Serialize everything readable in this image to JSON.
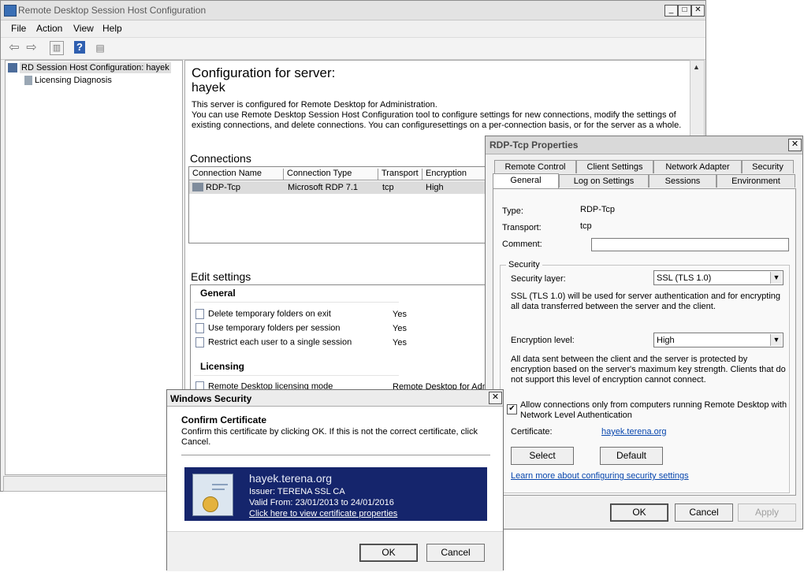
{
  "main_window": {
    "title": "Remote Desktop Session Host Configuration",
    "controls": {
      "minimize": "_",
      "maximize": "□",
      "close": "✕"
    },
    "menu": [
      "File",
      "Action",
      "View",
      "Help"
    ]
  },
  "tree": {
    "root": "RD Session Host Configuration: hayek",
    "child": "Licensing Diagnosis"
  },
  "content": {
    "heading": "Configuration for server:",
    "server": "hayek",
    "desc_line1": "This server is configured for Remote Desktop for Administration.",
    "desc_line2": "You can use Remote Desktop Session Host Configuration tool to configure settings for new connections, modify the settings of",
    "desc_line3": "existing connections, and delete connections. You can configuresettings on a per-connection basis, or for the server as a whole.",
    "connections_title": "Connections",
    "columns": [
      "Connection Name",
      "Connection Type",
      "Transport",
      "Encryption"
    ],
    "connection_row": {
      "name": "RDP-Tcp",
      "type": "Microsoft RDP 7.1",
      "transport": "tcp",
      "encryption": "High"
    },
    "edit_title": "Edit settings",
    "general_title": "General",
    "settings": [
      {
        "label": "Delete temporary folders on exit",
        "value": "Yes"
      },
      {
        "label": "Use temporary folders per session",
        "value": "Yes"
      },
      {
        "label": "Restrict each user to a single session",
        "value": "Yes"
      }
    ],
    "licensing_title": "Licensing",
    "licensing_row": {
      "label": "Remote Desktop licensing mode",
      "value": "Remote Desktop for Adm"
    }
  },
  "props": {
    "title": "RDP-Tcp Properties",
    "tabs_row1": [
      "Remote Control",
      "Client Settings",
      "Network Adapter",
      "Security"
    ],
    "tabs_row2": [
      "General",
      "Log on Settings",
      "Sessions",
      "Environment"
    ],
    "type_label": "Type:",
    "type_value": "RDP-Tcp",
    "transport_label": "Transport:",
    "transport_value": "tcp",
    "comment_label": "Comment:",
    "comment_value": "",
    "security_group": "Security",
    "security_layer_label": "Security layer:",
    "security_layer_value": "SSL (TLS 1.0)",
    "security_desc": "SSL (TLS 1.0) will be used for server authentication and for encrypting all data transferred between the server and the client.",
    "encryption_label": "Encryption level:",
    "encryption_value": "High",
    "encryption_desc": "All data sent between the client and the server is protected by encryption based on the server's maximum key strength. Clients that do not support this level of encryption cannot connect.",
    "nla_checked": true,
    "nla_label": "Allow connections only from computers running Remote Desktop with Network Level Authentication",
    "certificate_label": "Certificate:",
    "certificate_value": "hayek.terena.org",
    "select_btn": "Select",
    "default_btn": "Default",
    "learn_link": "Learn more about configuring security settings",
    "ok": "OK",
    "cancel": "Cancel",
    "apply": "Apply"
  },
  "security_dialog": {
    "title": "Windows Security",
    "heading": "Confirm Certificate",
    "message": "Confirm this certificate by clicking OK. If this is not the correct certificate, click Cancel.",
    "cert_name": "hayek.terena.org",
    "issuer": "Issuer: TERENA SSL CA",
    "valid": "Valid From: 23/01/2013 to 24/01/2016",
    "view_link": "Click here to view certificate properties",
    "ok": "OK",
    "cancel": "Cancel"
  }
}
